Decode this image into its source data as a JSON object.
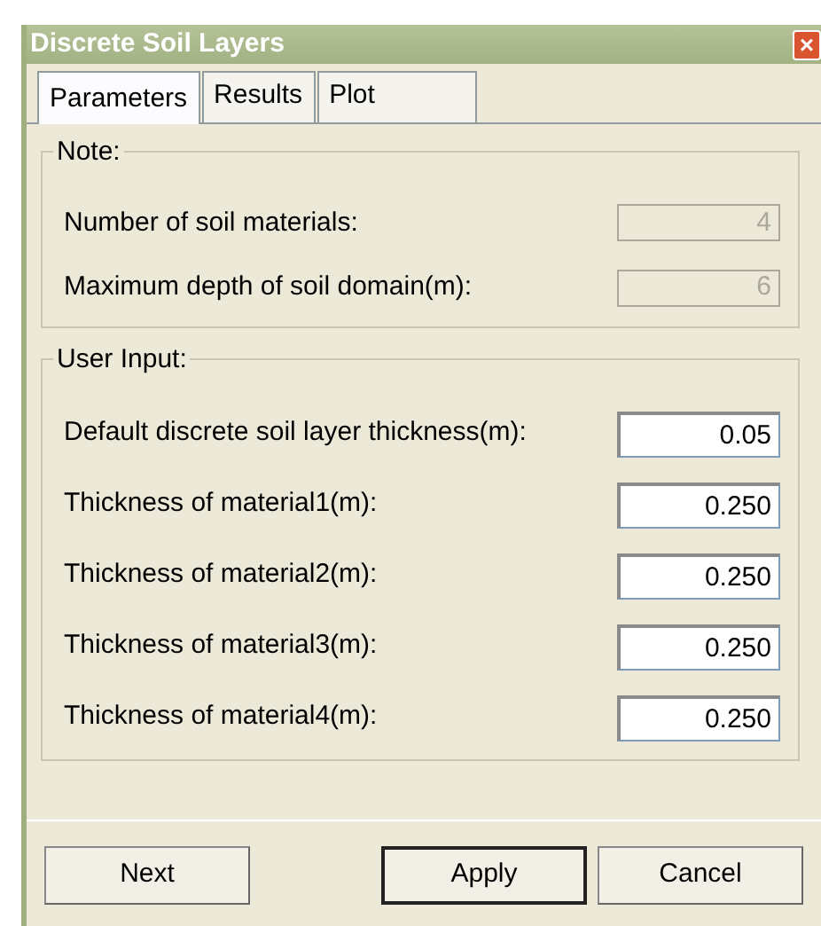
{
  "window": {
    "title": "Discrete Soil Layers",
    "close": "×"
  },
  "tabs": [
    {
      "label": "Parameters",
      "selected": true
    },
    {
      "label": "Results",
      "selected": false
    },
    {
      "label": "Plot",
      "selected": false
    }
  ],
  "groups": [
    {
      "title": "Note:",
      "fields": [
        {
          "label": "Number of soil materials:",
          "value": "4",
          "disabled": true
        },
        {
          "label": "Maximum depth of soil domain(m):",
          "value": "6",
          "disabled": true
        }
      ]
    },
    {
      "title": "User Input:",
      "fields": [
        {
          "label": "Default discrete soil layer thickness(m):",
          "value": "0.05",
          "disabled": false
        },
        {
          "label": "Thickness of material1(m):",
          "value": "0.250",
          "disabled": false
        },
        {
          "label": "Thickness of material2(m):",
          "value": "0.250",
          "disabled": false
        },
        {
          "label": "Thickness of material3(m):",
          "value": "0.250",
          "disabled": false
        },
        {
          "label": "Thickness of material4(m):",
          "value": "0.250",
          "disabled": false
        }
      ]
    }
  ],
  "buttons": [
    {
      "label": "Next",
      "default": false
    },
    {
      "label": "Apply",
      "default": true
    },
    {
      "label": "Cancel",
      "default": false
    }
  ]
}
